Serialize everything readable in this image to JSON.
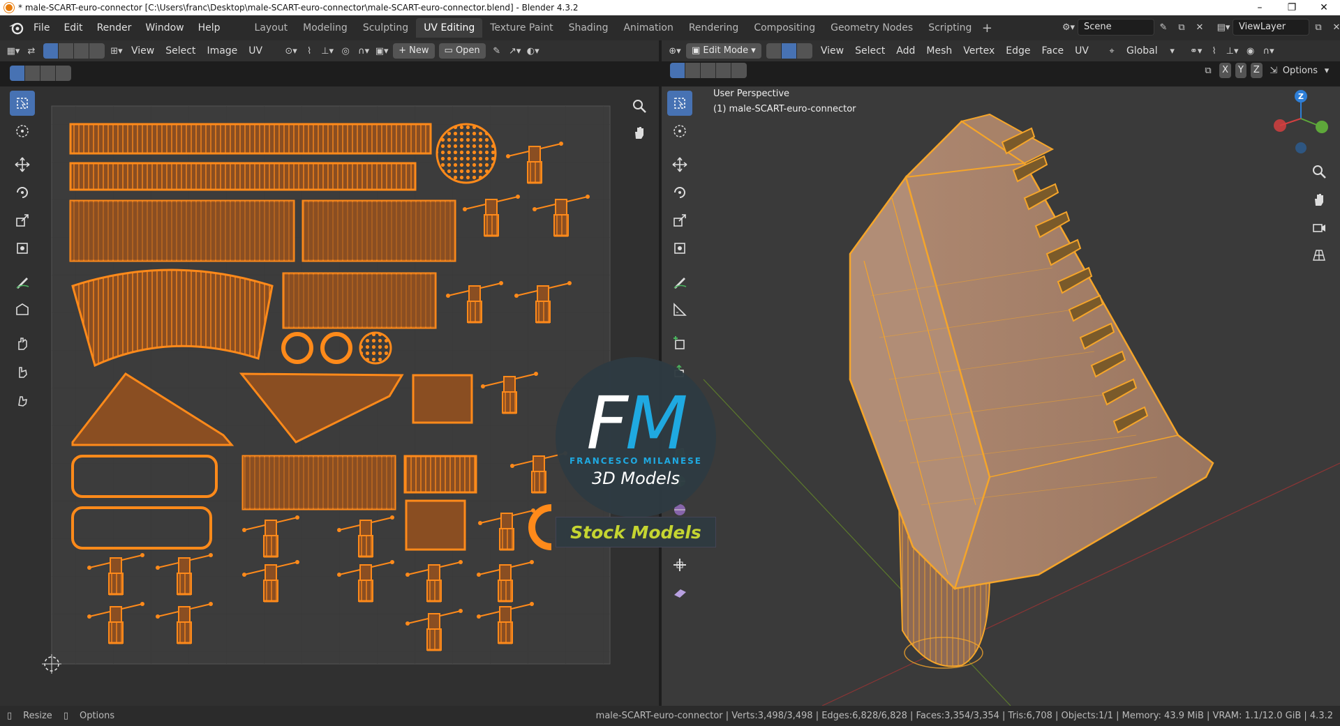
{
  "window": {
    "title": "* male-SCART-euro-connector [C:\\Users\\franc\\Desktop\\male-SCART-euro-connector\\male-SCART-euro-connector.blend] - Blender 4.3.2",
    "controls": [
      "–",
      "❐",
      "✕"
    ]
  },
  "menus": [
    "File",
    "Edit",
    "Render",
    "Window",
    "Help"
  ],
  "workspaces": [
    {
      "label": "Layout",
      "active": false
    },
    {
      "label": "Modeling",
      "active": false
    },
    {
      "label": "Sculpting",
      "active": false
    },
    {
      "label": "UV Editing",
      "active": true
    },
    {
      "label": "Texture Paint",
      "active": false
    },
    {
      "label": "Shading",
      "active": false
    },
    {
      "label": "Animation",
      "active": false
    },
    {
      "label": "Rendering",
      "active": false
    },
    {
      "label": "Compositing",
      "active": false
    },
    {
      "label": "Geometry Nodes",
      "active": false
    },
    {
      "label": "Scripting",
      "active": false
    }
  ],
  "scene": {
    "name": "Scene",
    "view_layer": "ViewLayer"
  },
  "uv_editor": {
    "menus": [
      "View",
      "Select",
      "Image",
      "UV"
    ],
    "new_label": "New",
    "open_label": "Open"
  },
  "viewport": {
    "mode": "Edit Mode",
    "menus": [
      "View",
      "Select",
      "Add",
      "Mesh",
      "Vertex",
      "Edge",
      "Face",
      "UV"
    ],
    "orientation": "Global",
    "axes": [
      "X",
      "Y",
      "Z"
    ],
    "options_label": "Options",
    "perspective_label": "User Perspective",
    "object_label": "(1) male-SCART-euro-connector",
    "gizmo_axis": "Z"
  },
  "watermark": {
    "fm_f": "F",
    "fm_m": "M",
    "name": "FRANCESCO MILANESE",
    "subtitle": "3D Models",
    "stock": "Stock Models"
  },
  "status": {
    "resize": "Resize",
    "options": "Options",
    "stats": "male-SCART-euro-connector | Verts:3,498/3,498 | Edges:6,828/6,828 | Faces:3,354/3,354 | Tris:6,708 | Objects:1/1 | Memory: 43.9 MiB | VRAM: 1.1/12.0 GiB | 4.3.2"
  },
  "colors": {
    "accent": "#4772b3",
    "uv_orange": "#ff8a1a",
    "selected_mesh": "#f5a52a"
  }
}
